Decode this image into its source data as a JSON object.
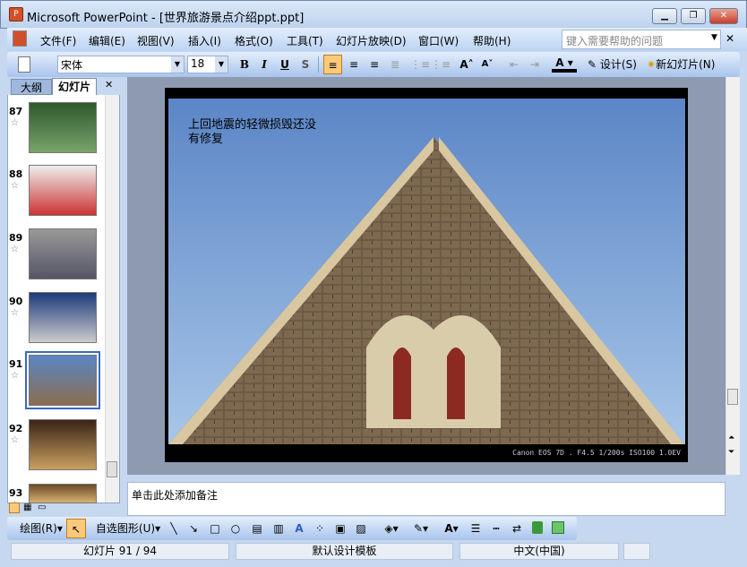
{
  "window": {
    "title": "Microsoft PowerPoint - [世界旅游景点介绍ppt.ppt]",
    "minimize": "▁",
    "restore": "❐",
    "close": "✕"
  },
  "menu": [
    "文件(F)",
    "编辑(E)",
    "视图(V)",
    "插入(I)",
    "格式(O)",
    "工具(T)",
    "幻灯片放映(D)",
    "窗口(W)",
    "帮助(H)"
  ],
  "help_placeholder": "键入需要帮助的问题",
  "toolbar": {
    "font": "宋体",
    "size": "18",
    "bold": "B",
    "italic": "I",
    "underline": "U",
    "shadow": "S",
    "design": "设计(S)",
    "new_slide": "新幻灯片(N)"
  },
  "panel": {
    "tab_outline": "大纲",
    "tab_slides": "幻灯片",
    "close": "✕"
  },
  "slides": [
    {
      "num": "87"
    },
    {
      "num": "88"
    },
    {
      "num": "89"
    },
    {
      "num": "90"
    },
    {
      "num": "91",
      "selected": true
    },
    {
      "num": "92"
    },
    {
      "num": "93"
    }
  ],
  "slide": {
    "text_line1": "上回地震的轻微损毁还没",
    "text_line2": "有修复",
    "caption": "Canon EOS 7D . F4.5 1/200s ISO100 1.0EV"
  },
  "notes_placeholder": "单击此处添加备注",
  "drawing": {
    "draw": "绘图(R)",
    "autoshapes": "自选图形(U)"
  },
  "status": {
    "slide": "幻灯片 91 / 94",
    "template": "默认设计模板",
    "language": "中文(中国)"
  }
}
